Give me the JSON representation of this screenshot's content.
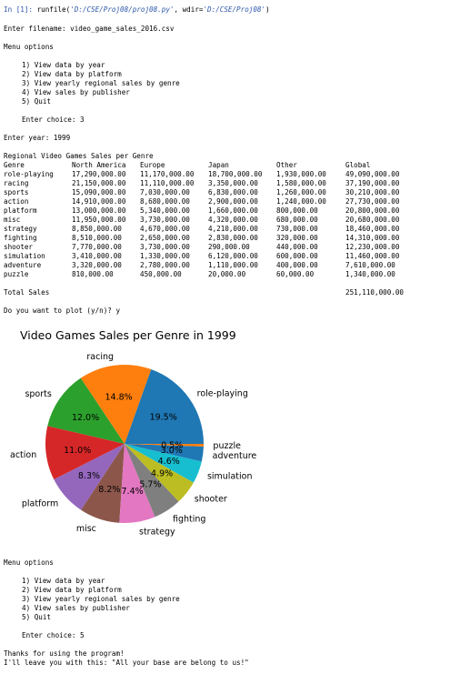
{
  "console": {
    "in_prompt": "In [1]:",
    "run_call_prefix": " runfile(",
    "run_file": "'D:/CSE/Proj08/proj08.py'",
    "run_call_mid": ", wdir=",
    "run_wdir": "'D:/CSE/Proj08'",
    "run_call_suffix": ")",
    "filename_line": "Enter filename: video_game_sales_2016.csv",
    "menu_title": "Menu options",
    "menu_items": [
      "1) View data by year",
      "2) View data by platform",
      "3) View yearly regional sales by genre",
      "4) View sales by publisher",
      "5) Quit"
    ],
    "choice1_line": "Enter choice: 3",
    "year_line": "Enter year: 1999",
    "table_title": "Regional Video Games Sales per Genre",
    "table_headers": [
      "Genre",
      "North America",
      "Europe",
      "Japan",
      "Other",
      "Global"
    ],
    "table_rows": [
      [
        "role-playing",
        "17,290,000.00",
        "11,170,000.00",
        "18,700,000.00",
        "1,930,000.00",
        "49,090,000.00"
      ],
      [
        "racing",
        "21,150,000.00",
        "11,110,000.00",
        "3,350,000.00",
        "1,580,000.00",
        "37,190,000.00"
      ],
      [
        "sports",
        "15,090,000.00",
        "7,030,000.00",
        "6,830,000.00",
        "1,260,000.00",
        "30,210,000.00"
      ],
      [
        "action",
        "14,910,000.00",
        "8,680,000.00",
        "2,900,000.00",
        "1,240,000.00",
        "27,730,000.00"
      ],
      [
        "platform",
        "13,000,000.00",
        "5,340,000.00",
        "1,660,000.00",
        "800,000.00",
        "20,800,000.00"
      ],
      [
        "misc",
        "11,950,000.00",
        "3,730,000.00",
        "4,320,000.00",
        "680,000.00",
        "20,680,000.00"
      ],
      [
        "strategy",
        "8,850,000.00",
        "4,670,000.00",
        "4,210,000.00",
        "730,000.00",
        "18,460,000.00"
      ],
      [
        "fighting",
        "8,510,000.00",
        "2,650,000.00",
        "2,830,000.00",
        "320,000.00",
        "14,310,000.00"
      ],
      [
        "shooter",
        "7,770,000.00",
        "3,730,000.00",
        "290,000.00",
        "440,000.00",
        "12,230,000.00"
      ],
      [
        "simulation",
        "3,410,000.00",
        "1,330,000.00",
        "6,120,000.00",
        "600,000.00",
        "11,460,000.00"
      ],
      [
        "adventure",
        "3,320,000.00",
        "2,780,000.00",
        "1,110,000.00",
        "400,000.00",
        "7,610,000.00"
      ],
      [
        "puzzle",
        "810,000.00",
        "450,000.00",
        "20,000.00",
        "60,000.00",
        "1,340,000.00"
      ]
    ],
    "total_label": "Total Sales",
    "total_value": "251,110,000.00",
    "plot_prompt": "Do you want to plot (y/n)? y",
    "choice2_line": "Enter choice: 5",
    "thanks_line": "Thanks for using the program!",
    "farewell_line": "I'll leave you with this: \"All your base are belong to us!\""
  },
  "chart_data": {
    "type": "pie",
    "title": "Video Games Sales per Genre in 1999",
    "start_angle_deg": 0,
    "direction": "counterclockwise",
    "slices": [
      {
        "label": "role-playing",
        "value": 49090000,
        "pct_label": "19.5%",
        "color": "#1f77b4"
      },
      {
        "label": "racing",
        "value": 37190000,
        "pct_label": "14.8%",
        "color": "#ff7f0e"
      },
      {
        "label": "sports",
        "value": 30210000,
        "pct_label": "12.0%",
        "color": "#2ca02c"
      },
      {
        "label": "action",
        "value": 27730000,
        "pct_label": "11.0%",
        "color": "#d62728"
      },
      {
        "label": "platform",
        "value": 20800000,
        "pct_label": "8.3%",
        "color": "#9467bd"
      },
      {
        "label": "misc",
        "value": 20680000,
        "pct_label": "8.2%",
        "color": "#8c564b"
      },
      {
        "label": "strategy",
        "value": 18460000,
        "pct_label": "7.4%",
        "color": "#e377c2"
      },
      {
        "label": "fighting",
        "value": 14310000,
        "pct_label": "5.7%",
        "color": "#7f7f7f"
      },
      {
        "label": "shooter",
        "value": 12230000,
        "pct_label": "4.9%",
        "color": "#bcbd22"
      },
      {
        "label": "simulation",
        "value": 11460000,
        "pct_label": "4.6%",
        "color": "#17becf"
      },
      {
        "label": "adventure",
        "value": 7610000,
        "pct_label": "3.0%",
        "color": "#1f77b4"
      },
      {
        "label": "puzzle",
        "value": 1340000,
        "pct_label": "0.5%",
        "color": "#ff7f0e"
      }
    ]
  }
}
